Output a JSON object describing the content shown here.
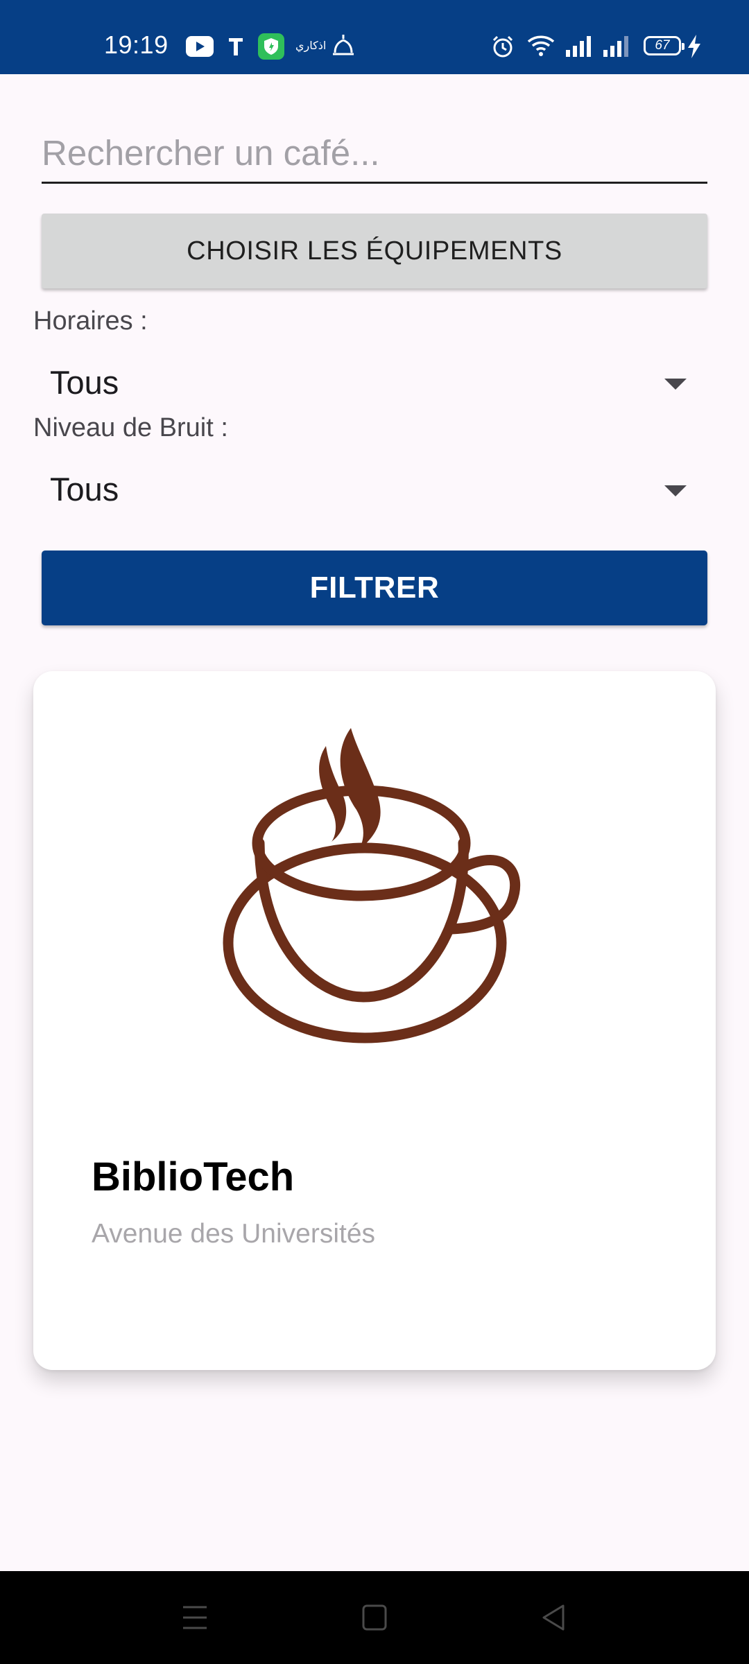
{
  "status_bar": {
    "time": "19:19",
    "battery": "67",
    "background_color": "#063f86",
    "icons": [
      "youtube-icon",
      "t-app-icon",
      "shield-app-icon",
      "arabic-app-icon",
      "mosque-app-icon",
      "alarm-icon",
      "wifi-icon",
      "signal-icon",
      "signal-icon-2",
      "battery-icon",
      "charging-icon"
    ],
    "arabic_app_label": "اذكاري"
  },
  "search": {
    "placeholder": "Rechercher un café..."
  },
  "equipment_button": {
    "label": "CHOISIR LES ÉQUIPEMENTS"
  },
  "filters": {
    "hours": {
      "label": "Horaires :",
      "value": "Tous"
    },
    "noise": {
      "label": "Niveau de Bruit :",
      "value": "Tous"
    }
  },
  "filter_button": {
    "label": "FILTRER",
    "color": "#063f86"
  },
  "cafes": [
    {
      "name": "BiblioTech",
      "address": "Avenue des Universités",
      "image_icon": "coffee-cup-icon",
      "icon_color": "#6b2e19"
    }
  ],
  "nav_bar": {
    "icons": [
      "menu-icon",
      "home-icon",
      "back-icon"
    ]
  }
}
